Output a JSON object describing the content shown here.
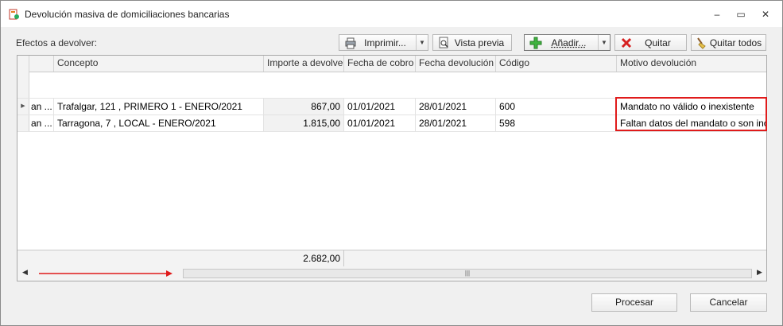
{
  "window": {
    "title": "Devolución masiva de domiciliaciones bancarias",
    "minimize_glyph": "–",
    "restore_glyph": "▭",
    "close_glyph": "✕"
  },
  "toolbar": {
    "label": "Efectos a devolver:",
    "print": "Imprimir...",
    "preview": "Vista previa",
    "add": "Añadir...",
    "remove": "Quitar",
    "remove_all": "Quitar todos"
  },
  "grid": {
    "columns": [
      "Concepto",
      "Importe a devolver",
      "Fecha de cobro",
      "Fecha devolución",
      "Código",
      "Motivo devolución"
    ],
    "rows": [
      {
        "col1": "an ...",
        "concepto": "Trafalgar, 121 , PRIMERO 1 - ENERO/2021",
        "importe": "867,00",
        "fecha_cobro": "01/01/2021",
        "fecha_devolucion": "28/01/2021",
        "codigo": "600",
        "motivo": "Mandato no válido o inexistente"
      },
      {
        "col1": "an ...",
        "concepto": "Tarragona, 7 , LOCAL - ENERO/2021",
        "importe": "1.815,00",
        "fecha_cobro": "01/01/2021",
        "fecha_devolucion": "28/01/2021",
        "codigo": "598",
        "motivo": "Faltan datos del mandato o son inc..."
      }
    ],
    "total": "2.682,00"
  },
  "buttons": {
    "process": "Procesar",
    "cancel": "Cancelar"
  },
  "icons": {
    "app": "document-gear-icon",
    "print": "printer-icon",
    "preview": "magnifier-icon",
    "add": "plus-icon",
    "remove": "red-x-icon",
    "remove_all": "broom-icon"
  },
  "colors": {
    "highlight": "#e01b1b",
    "add_icon": "#3fb33f"
  }
}
